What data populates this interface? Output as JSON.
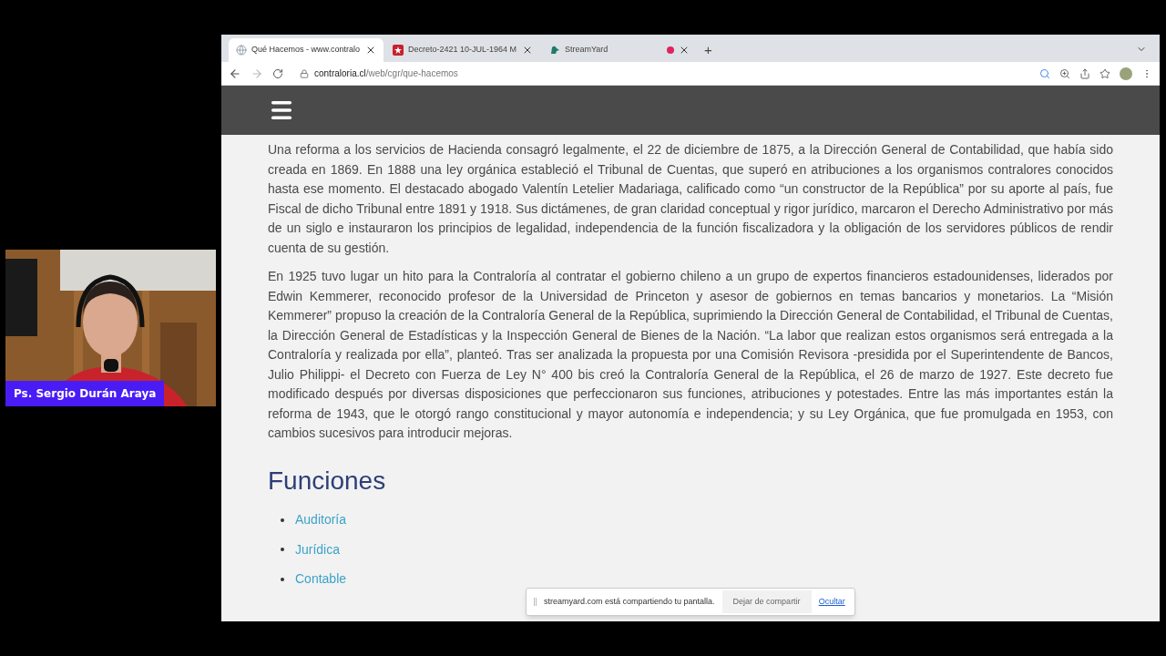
{
  "camera": {
    "kind": "picture",
    "name": "Ps. Sergio Durán Araya"
  },
  "browser": {
    "tabs": [
      {
        "title": "Qué Hacemos - www.contralo",
        "selected": true,
        "kind": "globe",
        "recording": false
      },
      {
        "title": "Decreto-2421 10-JUL-1964 M",
        "selected": false,
        "kind": "doc",
        "recording": false
      },
      {
        "title": "StreamYard",
        "selected": false,
        "kind": "streamyard",
        "recording": true
      }
    ],
    "new_tab": "+",
    "url_host": "contraloria.cl",
    "url_path": "/web/cgr/que-hacemos"
  },
  "site": {
    "paragraphs": [
      "Una reforma a los servicios de Hacienda consagró legalmente, el 22 de diciembre de 1875, a la Dirección General de Contabilidad, que había sido creada en 1869. En 1888 una ley orgánica estableció el Tribunal de Cuentas, que superó en atribuciones a los organismos contralores conocidos hasta ese momento. El destacado abogado Valentín Letelier Madariaga, calificado como “un constructor de la República” por su aporte al país, fue Fiscal de dicho Tribunal entre 1891 y 1918. Sus dictámenes, de gran claridad conceptual y rigor jurídico, marcaron el Derecho Administrativo por más de un siglo e instauraron los principios de legalidad, independencia de la función fiscalizadora y la obligación de los servidores públicos de rendir cuenta de su gestión.",
      "En 1925 tuvo lugar un hito para la Contraloría al contratar el gobierno chileno a un grupo de expertos financieros estadounidenses, liderados por Edwin Kemmerer, reconocido profesor de la Universidad de Princeton y asesor de gobiernos en temas bancarios y monetarios. La “Misión Kemmerer” propuso la creación de la Contraloría General de la República, suprimiendo la Dirección General de Contabilidad, el Tribunal de Cuentas, la Dirección General de Estadísticas y la Inspección General de Bienes de la Nación.  “La labor que realizan estos organismos será entregada a la Contraloría y realizada por ella”, planteó. Tras ser analizada la propuesta por una Comisión Revisora -presidida por el Superintendente de Bancos, Julio Philippi- el Decreto con Fuerza de Ley N° 400 bis creó la Contraloría General de la República, el 26 de marzo de 1927. Este decreto fue modificado después por diversas disposiciones que perfeccionaron sus funciones, atribuciones y potestades. Entre las más importantes están la reforma de 1943, que le otorgó rango constitucional y mayor autonomía e independencia; y su Ley Orgánica, que fue promulgada en 1953, con cambios sucesivos para introducir mejoras."
    ],
    "heading": "Funciones",
    "functions": [
      "Auditoría",
      "Jurídica",
      "Contable"
    ]
  },
  "share_bar": {
    "message": "streamyard.com está compartiendo tu pantalla.",
    "stop": "Dejar de compartir",
    "hide": "Ocultar"
  }
}
